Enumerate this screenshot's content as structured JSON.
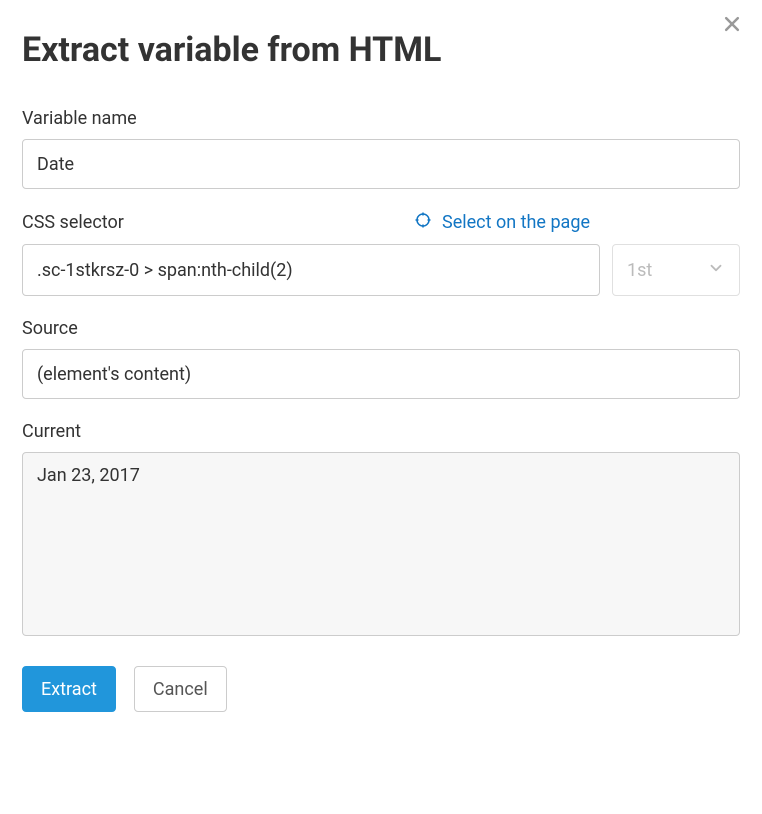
{
  "dialog": {
    "title": "Extract variable from HTML"
  },
  "fields": {
    "variable_name": {
      "label": "Variable name",
      "value": "Date"
    },
    "css_selector": {
      "label": "CSS selector",
      "select_link": "Select on the page",
      "value": ".sc-1stkrsz-0 > span:nth-child(2)",
      "ordinal": "1st"
    },
    "source": {
      "label": "Source",
      "value": "(element's content)"
    },
    "current": {
      "label": "Current",
      "value": "Jan 23, 2017"
    }
  },
  "buttons": {
    "extract": "Extract",
    "cancel": "Cancel"
  }
}
